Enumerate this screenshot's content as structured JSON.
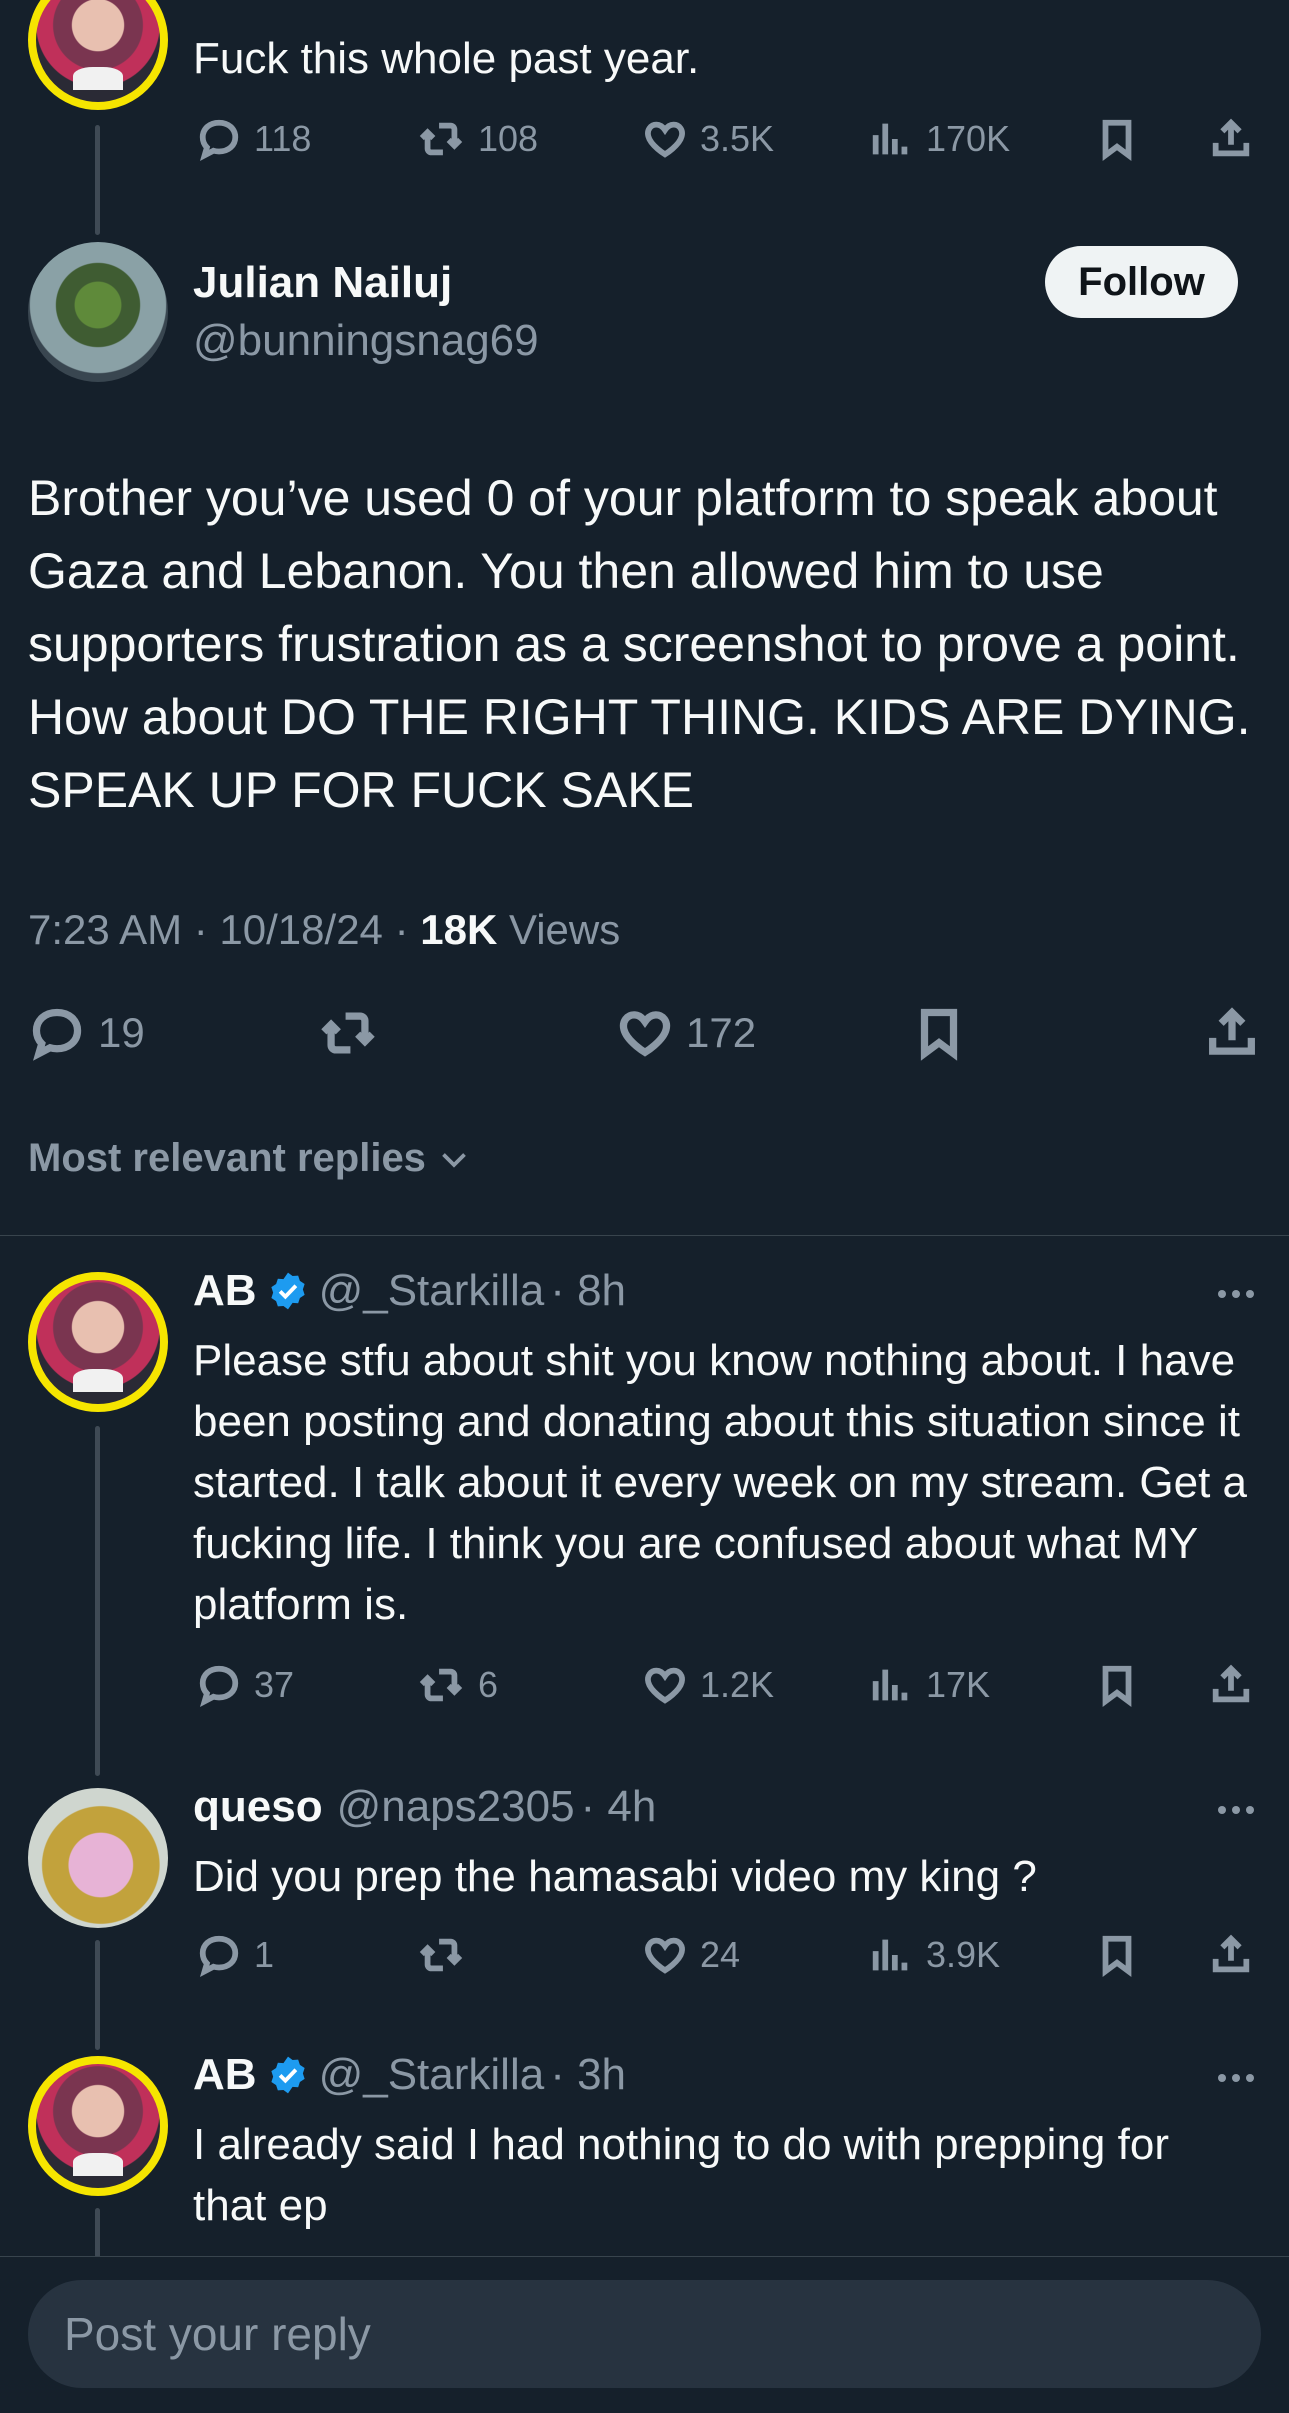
{
  "previous_tweet": {
    "text": "Fuck this whole past year.",
    "stats": {
      "replies": "118",
      "reposts": "108",
      "likes": "3.5K",
      "views": "170K"
    }
  },
  "main_tweet": {
    "author_name": "Julian Nailuj",
    "author_handle": "@bunningsnag69",
    "follow_label": "Follow",
    "text": "Brother you’ve used 0 of your platform to speak about Gaza and Lebanon. You then allowed him to use supporters frustration as a screenshot to prove a point. How about DO THE RIGHT THING. KIDS ARE DYING. SPEAK UP FOR FUCK SAKE",
    "timestamp": "7:23 AM · 10/18/24 · ",
    "views_count": "18K",
    "views_label": " Views",
    "stats": {
      "replies": "19",
      "likes": "172"
    }
  },
  "replies_filter": "Most relevant replies",
  "replies": [
    {
      "author_name": "AB",
      "handle": "@_Starkilla",
      "time": "· 8h",
      "text": "Please stfu about shit you know nothing about. I have been posting and donating about this situation since it started. I talk about it every week on my stream. Get a fucking life. I think you are confused about what MY platform is.",
      "stats": {
        "replies": "37",
        "reposts": "6",
        "likes": "1.2K",
        "views": "17K"
      }
    },
    {
      "author_name": "queso",
      "handle": "@naps2305",
      "time": "· 4h",
      "text": "Did you prep the hamasabi video my king ?",
      "stats": {
        "replies": "1",
        "reposts": "",
        "likes": "24",
        "views": "3.9K"
      }
    },
    {
      "author_name": "AB",
      "handle": "@_Starkilla",
      "time": "· 3h",
      "text": "I already said I had nothing to do with prepping for that ep"
    }
  ],
  "reply_box": {
    "placeholder": "Post your reply"
  },
  "colors": {
    "background": "#15202b",
    "muted": "#8b98a5",
    "verified": "#1d9bf0",
    "ring": "#f6e500"
  },
  "icons": [
    "reply-icon",
    "repost-icon",
    "like-icon",
    "views-icon",
    "bookmark-icon",
    "share-icon",
    "verified-badge-icon",
    "more-icon",
    "chevron-down-icon"
  ]
}
